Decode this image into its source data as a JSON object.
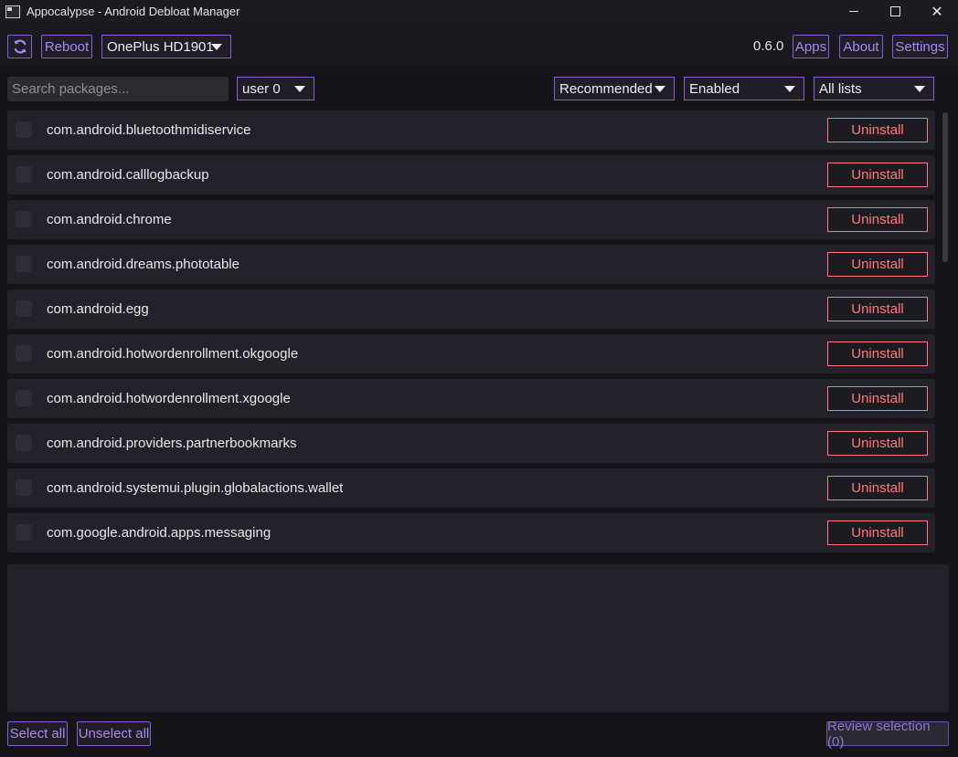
{
  "window": {
    "title": "Appocalypse - Android Debloat Manager"
  },
  "toolbar": {
    "refresh_icon": "refresh-icon",
    "reboot_label": "Reboot",
    "device": "OnePlus HD1901",
    "version": "0.6.0",
    "apps_label": "Apps",
    "about_label": "About",
    "settings_label": "Settings"
  },
  "filters": {
    "search_placeholder": "Search packages...",
    "user": "user 0",
    "recommendation": "Recommended",
    "state": "Enabled",
    "list": "All lists"
  },
  "packages": [
    {
      "name": "com.android.bluetoothmidiservice",
      "action": "Uninstall"
    },
    {
      "name": "com.android.calllogbackup",
      "action": "Uninstall"
    },
    {
      "name": "com.android.chrome",
      "action": "Uninstall"
    },
    {
      "name": "com.android.dreams.phototable",
      "action": "Uninstall"
    },
    {
      "name": "com.android.egg",
      "action": "Uninstall"
    },
    {
      "name": "com.android.hotwordenrollment.okgoogle",
      "action": "Uninstall"
    },
    {
      "name": "com.android.hotwordenrollment.xgoogle",
      "action": "Uninstall"
    },
    {
      "name": "com.android.providers.partnerbookmarks",
      "action": "Uninstall"
    },
    {
      "name": "com.android.systemui.plugin.globalactions.wallet",
      "action": "Uninstall"
    },
    {
      "name": "com.google.android.apps.messaging",
      "action": "Uninstall"
    }
  ],
  "bottom": {
    "select_all": "Select all",
    "unselect_all": "Unselect all",
    "review": "Review selection (0)"
  },
  "colors": {
    "accent": "#8b5cd6",
    "danger": "#ff7b7b",
    "background": "#141419"
  }
}
